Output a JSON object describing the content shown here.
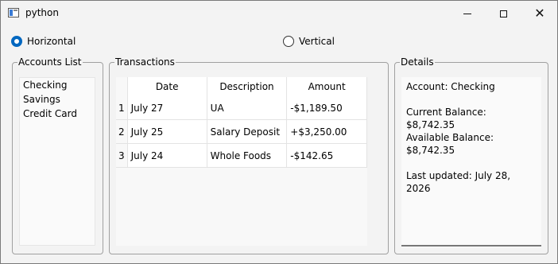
{
  "window": {
    "title": "python",
    "icon": "app-icon"
  },
  "layout_options": {
    "horizontal_label": "Horizontal",
    "vertical_label": "Vertical",
    "selected": "Horizontal"
  },
  "accounts": {
    "title": "Accounts List",
    "items": [
      "Checking",
      "Savings",
      "Credit Card"
    ]
  },
  "transactions": {
    "title": "Transactions",
    "columns": [
      "Date",
      "Description",
      "Amount"
    ],
    "rows": [
      {
        "num": "1",
        "date": "July 27",
        "description": "UA",
        "amount": "-$1,189.50"
      },
      {
        "num": "2",
        "date": "July 25",
        "description": "Salary Deposit",
        "amount": "+$3,250.00"
      },
      {
        "num": "3",
        "date": "July 24",
        "description": "Whole Foods",
        "amount": "-$142.65"
      }
    ]
  },
  "details": {
    "title": "Details",
    "account": "Account: Checking",
    "current_balance": "Current Balance: $8,742.35",
    "available_balance": "Available Balance: $8,742.35",
    "last_updated": "Last updated: July 28, 2026"
  }
}
